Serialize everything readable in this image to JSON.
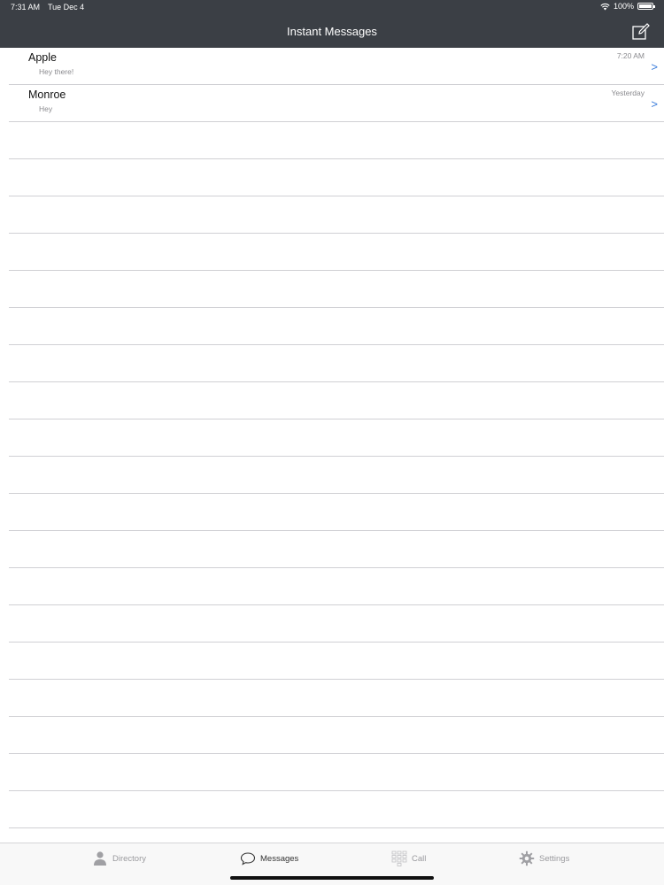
{
  "status_bar": {
    "time": "7:31 AM",
    "date": "Tue Dec 4",
    "battery": "100%"
  },
  "nav": {
    "title": "Instant Messages",
    "compose_icon": "compose-icon"
  },
  "conversations": [
    {
      "name": "Apple",
      "preview": "Hey there!",
      "time": "7:20 AM",
      "chevron": ">"
    },
    {
      "name": "Monroe",
      "preview": "Hey",
      "time": "Yesterday",
      "chevron": ">"
    }
  ],
  "tabs": [
    {
      "label": "Directory",
      "icon": "person-icon",
      "active": false
    },
    {
      "label": "Messages",
      "icon": "chat-bubble-icon",
      "active": true
    },
    {
      "label": "Call",
      "icon": "keypad-icon",
      "active": false
    },
    {
      "label": "Settings",
      "icon": "gear-icon",
      "active": false
    }
  ],
  "colors": {
    "bar": "#3b3f45",
    "accent": "#3b7ddb",
    "separator": "#d0d0d4"
  }
}
